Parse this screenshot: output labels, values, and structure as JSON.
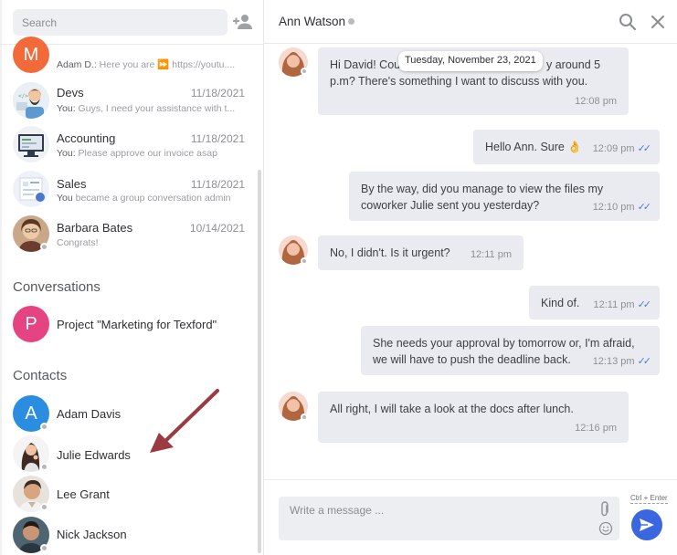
{
  "sidebar": {
    "search_placeholder": "Search",
    "chats": [
      {
        "name": "",
        "preview_sender": "Adam D.:",
        "preview": " Here you are ⏩ https://youtu....",
        "date": "",
        "avatar_letter": "M",
        "avatar_color": "#f26a3a"
      },
      {
        "name": "Devs",
        "preview_sender": "You:",
        "preview": " Guys, I need your assistance with t...",
        "date": "11/18/2021"
      },
      {
        "name": "Accounting",
        "preview_sender": "You:",
        "preview": " Please approve our invoice asap",
        "date": "11/18/2021"
      },
      {
        "name": "Sales",
        "preview_sender": "You",
        "preview": " became a group conversation admin",
        "date": "11/18/2021"
      },
      {
        "name": "Barbara Bates",
        "preview_sender": "",
        "preview": "Congrats!",
        "date": "10/14/2021"
      }
    ],
    "conversations_title": "Conversations",
    "conversations": [
      {
        "name": "Project \"Marketing for Texford\"",
        "avatar_letter": "P",
        "avatar_color": "#e64383"
      }
    ],
    "contacts_title": "Contacts",
    "contacts": [
      {
        "name": "Adam Davis",
        "avatar_letter": "A",
        "avatar_color": "#2a8de0"
      },
      {
        "name": "Julie Edwards"
      },
      {
        "name": "Lee Grant"
      },
      {
        "name": "Nick Jackson"
      }
    ]
  },
  "chat": {
    "title": "Ann Watson",
    "date_divider": "Tuesday, November 23, 2021",
    "messages": [
      {
        "from": "them",
        "line1": "Hi David! Cou",
        "line1b": "y around 5",
        "line2": "p.m? There's something I want to discuss with you.",
        "time": "12:08 pm"
      },
      {
        "from": "me",
        "text": "Hello Ann. Sure 👌",
        "time": "12:09 pm"
      },
      {
        "from": "me",
        "line1": "By the way, did you manage to view the files my",
        "line2": "coworker Julie sent you yesterday?",
        "time": "12:10 pm"
      },
      {
        "from": "them",
        "text": "No, I didn't. Is it urgent?",
        "time": "12:11 pm"
      },
      {
        "from": "me",
        "text": "Kind of.",
        "time": "12:11 pm"
      },
      {
        "from": "me",
        "line1": "She needs your approval by tomorrow or, I'm afraid,",
        "line2": "we will have to push the deadline back.",
        "time": "12:13 pm"
      },
      {
        "from": "them",
        "text": "All right, I will take a look at the docs after lunch.",
        "time": "12:16 pm"
      }
    ]
  },
  "composer": {
    "placeholder": "Write a message ...",
    "shortcut_hint": "Ctrl + Enter"
  },
  "colors": {
    "accent": "#3a67e0",
    "bubble": "#eaebf0",
    "annotation_arrow": "#9b3b41"
  }
}
